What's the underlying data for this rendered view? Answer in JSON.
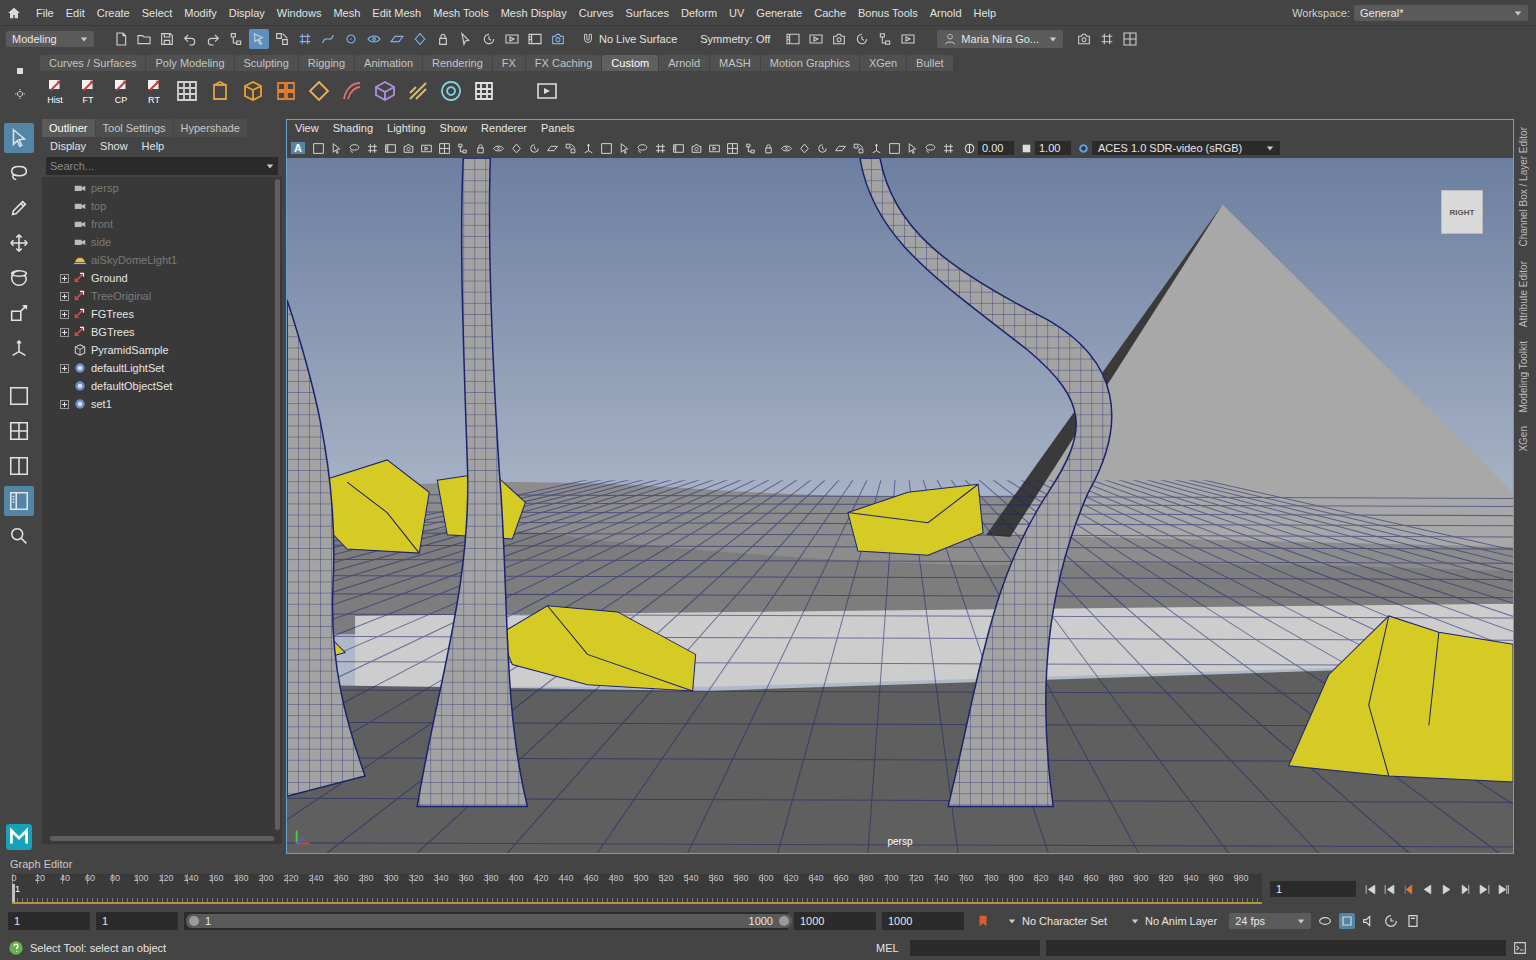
{
  "menubar": {
    "items": [
      "File",
      "Edit",
      "Create",
      "Select",
      "Modify",
      "Display",
      "Windows",
      "Mesh",
      "Edit Mesh",
      "Mesh Tools",
      "Mesh Display",
      "Curves",
      "Surfaces",
      "Deform",
      "UV",
      "Generate",
      "Cache",
      "Bonus Tools",
      "Arnold",
      "Help"
    ],
    "workspace_label": "Workspace:",
    "workspace": "General*"
  },
  "statusline": {
    "menu_set": "Modeling",
    "live_surface": "No Live Surface",
    "symmetry": "Symmetry: Off",
    "user": "Maria Nira Go...",
    "icons": [
      {
        "kind": "new",
        "on": false
      },
      {
        "kind": "open",
        "on": false
      },
      {
        "kind": "save",
        "on": false
      },
      {
        "kind": "undo",
        "on": false
      },
      {
        "kind": "redo",
        "on": false
      },
      {
        "kind": "hierarchy",
        "on": false
      },
      {
        "kind": "objectmode",
        "on": true
      },
      {
        "kind": "component",
        "on": false
      },
      {
        "kind": "snapgrid",
        "on": false
      },
      {
        "kind": "snapcurve",
        "on": false
      },
      {
        "kind": "snappoint",
        "on": false
      },
      {
        "kind": "snapview",
        "on": false
      },
      {
        "kind": "snapplane",
        "on": false
      },
      {
        "kind": "snaplive",
        "on": false
      },
      {
        "kind": "lock",
        "on": false
      },
      {
        "kind": "pick",
        "on": false
      },
      {
        "kind": "history",
        "on": false
      },
      {
        "kind": "ipr",
        "on": false
      },
      {
        "kind": "render",
        "on": false
      },
      {
        "kind": "snapshot",
        "on": false
      }
    ]
  },
  "shelf": {
    "tabs": [
      {
        "label": "Curves / Surfaces",
        "selected": false
      },
      {
        "label": "Poly Modeling",
        "selected": false
      },
      {
        "label": "Sculpting",
        "selected": false
      },
      {
        "label": "Rigging",
        "selected": false
      },
      {
        "label": "Animation",
        "selected": false
      },
      {
        "label": "Rendering",
        "selected": false
      },
      {
        "label": "FX",
        "selected": false
      },
      {
        "label": "FX Caching",
        "selected": false
      },
      {
        "label": "Custom",
        "selected": true
      },
      {
        "label": "Arnold",
        "selected": false
      },
      {
        "label": "MASH",
        "selected": false
      },
      {
        "label": "Motion Graphics",
        "selected": false
      },
      {
        "label": "XGen",
        "selected": false
      },
      {
        "label": "Bullet",
        "selected": false
      }
    ],
    "buttons": [
      {
        "label": "Hist"
      },
      {
        "label": "FT"
      },
      {
        "label": "CP"
      },
      {
        "label": "RT"
      }
    ]
  },
  "toolbox": {
    "tools": [
      {
        "kind": "select",
        "selected": true
      },
      {
        "kind": "lasso",
        "selected": false
      },
      {
        "kind": "paint",
        "selected": false
      },
      {
        "kind": "move",
        "selected": false
      },
      {
        "kind": "rotate",
        "selected": false
      },
      {
        "kind": "scale",
        "selected": false
      },
      {
        "kind": "manip",
        "selected": false
      }
    ],
    "layouts": [
      {
        "kind": "single",
        "selected": false
      },
      {
        "kind": "four",
        "selected": false
      },
      {
        "kind": "split",
        "selected": false
      },
      {
        "kind": "outlinerpersp",
        "selected": true
      },
      {
        "kind": "search",
        "selected": false
      }
    ]
  },
  "outliner": {
    "tabs": [
      {
        "label": "Outliner",
        "selected": true
      },
      {
        "label": "Tool Settings",
        "selected": false
      },
      {
        "label": "Hypershade",
        "selected": false
      }
    ],
    "menu": [
      "Display",
      "Show",
      "Help"
    ],
    "search_placeholder": "Search...",
    "items": [
      {
        "name": "persp",
        "kind": "camera",
        "hidden": true,
        "expandable": false
      },
      {
        "name": "top",
        "kind": "camera",
        "hidden": true,
        "expandable": false
      },
      {
        "name": "front",
        "kind": "camera",
        "hidden": true,
        "expandable": false
      },
      {
        "name": "side",
        "kind": "camera",
        "hidden": true,
        "expandable": false
      },
      {
        "name": "aiSkyDomeLight1",
        "kind": "light",
        "hidden": true,
        "expandable": false
      },
      {
        "name": "Ground",
        "kind": "group",
        "hidden": false,
        "expandable": true
      },
      {
        "name": "TreeOriginal",
        "kind": "group",
        "hidden": true,
        "expandable": true
      },
      {
        "name": "FGTrees",
        "kind": "group",
        "hidden": false,
        "expandable": true
      },
      {
        "name": "BGTrees",
        "kind": "group",
        "hidden": false,
        "expandable": true
      },
      {
        "name": "PyramidSample",
        "kind": "mesh",
        "hidden": false,
        "expandable": false
      },
      {
        "name": "defaultLightSet",
        "kind": "set",
        "hidden": false,
        "expandable": true
      },
      {
        "name": "defaultObjectSet",
        "kind": "set",
        "hidden": false,
        "expandable": false
      },
      {
        "name": "set1",
        "kind": "set",
        "hidden": false,
        "expandable": true
      }
    ]
  },
  "viewport": {
    "menu": [
      "View",
      "Shading",
      "Lighting",
      "Show",
      "Renderer",
      "Panels"
    ],
    "badge": "A",
    "exposure": "0.00",
    "gamma": "1.00",
    "color_space": "ACES 1.0 SDR-video (sRGB)",
    "view_cube": "RIGHT",
    "camera": "persp"
  },
  "side_tabs": [
    "Channel Box / Layer Editor",
    "Attribute Editor",
    "Modeling Toolkit",
    "XGen"
  ],
  "graph_editor": "Graph Editor",
  "timeline": {
    "ticks": [
      "0",
      "20",
      "40",
      "60",
      "80",
      "100",
      "120",
      "140",
      "160",
      "180",
      "200",
      "220",
      "240",
      "260",
      "280",
      "300",
      "320",
      "340",
      "360",
      "380",
      "400",
      "420",
      "440",
      "460",
      "480",
      "500",
      "520",
      "540",
      "560",
      "580",
      "600",
      "620",
      "640",
      "660",
      "680",
      "700",
      "720",
      "740",
      "760",
      "780",
      "800",
      "820",
      "840",
      "860",
      "880",
      "900",
      "920",
      "940",
      "960",
      "980"
    ],
    "playhead": "1",
    "current_frame": "1"
  },
  "range": {
    "start": "1",
    "anim_start": "1",
    "slider_start": "1",
    "slider_end": "1000",
    "level": 1,
    "anim_end": "1000",
    "end": "1000",
    "character_set": "No Character Set",
    "anim_layer": "No Anim Layer",
    "fps": "24 fps"
  },
  "command": {
    "help": "Select Tool: select an object",
    "language": "MEL"
  }
}
